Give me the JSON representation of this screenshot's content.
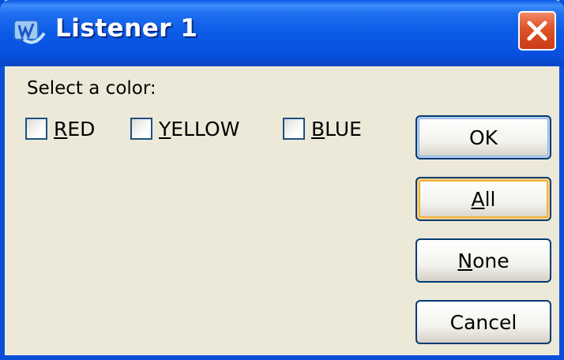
{
  "window": {
    "title": "Listener 1",
    "app_icon": "lw-app-icon",
    "close_icon": "close-icon"
  },
  "prompt": "Select a color:",
  "checkboxes": [
    {
      "label": "RED",
      "mnemonic": "R",
      "rest": "ED",
      "checked": false
    },
    {
      "label": "YELLOW",
      "mnemonic": "Y",
      "rest": "ELLOW",
      "checked": false
    },
    {
      "label": "BLUE",
      "mnemonic": "B",
      "rest": "LUE",
      "checked": false
    }
  ],
  "buttons": {
    "ok": {
      "label": "OK"
    },
    "all": {
      "label": "All",
      "mnemonic": "A",
      "rest": "ll"
    },
    "none": {
      "label": "None",
      "mnemonic": "N",
      "rest": "one"
    },
    "cancel": {
      "label": "Cancel"
    }
  },
  "colors": {
    "titlebar": "#0a58e8",
    "dialog_bg": "#ece9d8",
    "close_button": "#e0552a",
    "focus_ring": "#f1b03f"
  }
}
